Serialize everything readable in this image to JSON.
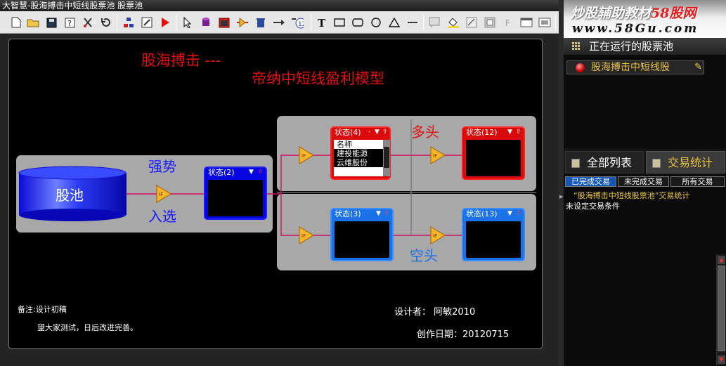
{
  "window": {
    "title": "大智慧-股海搏击中短线股票池  股票池"
  },
  "toolbar": {
    "icons": [
      "new-file",
      "open-folder",
      "save",
      "help",
      "cut-tool",
      "undo",
      "node-structure",
      "export",
      "run",
      "pointer",
      "database",
      "monitor-window",
      "filter-node",
      "trash",
      "arrow-connector",
      "condition-connector",
      "text",
      "rectangle",
      "rounded-rectangle",
      "ellipse",
      "triangle",
      "line",
      "image",
      "fill-color",
      "line-color",
      "fill-pattern",
      "font",
      "window-layout-1",
      "window-layout-2"
    ]
  },
  "canvas": {
    "title1": "股海搏击 ---",
    "title2": "帝纳中短线盈利模型",
    "pool_label": "股池",
    "strong_label": "强势",
    "enter_label": "入选",
    "long_label": "多头",
    "short_label": "空头",
    "states": {
      "s2": "状态(2)",
      "s4": "状态(4)",
      "s12": "状态(12)",
      "s3": "状态(3)",
      "s13": "状态(13)"
    },
    "s4_list": {
      "header": "名称",
      "items": [
        "建投能源",
        "云维股份"
      ]
    },
    "note_title": "备注:设计初稿",
    "note_text": "望大家测试，日后改进完善。",
    "designer": "设计者：  阿敏2010",
    "date": "创作日期：20120715",
    "colors": {
      "red": "#e01010",
      "blue": "#1a1aff",
      "gray_panel": "#a8a8a8"
    }
  },
  "side": {
    "brand_line1_a": "炒股辅助教材",
    "brand_line1_b": "58股网",
    "brand_line2": "www.58Gu.com",
    "running_pools": "正在运行的股票池",
    "pool_item": "股海搏击中短线股",
    "tab_all": "全部列表",
    "tab_stats": "交易统计",
    "subtab_done": "已完成交易",
    "subtab_undone": "未完成交易",
    "subtab_all": "所有交易",
    "stats_title": "“股海搏击中短线股票池”交易统计",
    "stats_note": "未设定交易条件"
  }
}
